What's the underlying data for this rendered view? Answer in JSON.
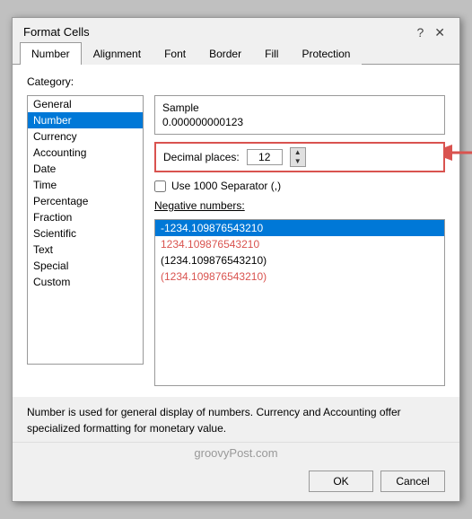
{
  "dialog": {
    "title": "Format Cells",
    "help_btn": "?",
    "close_btn": "✕"
  },
  "tabs": [
    {
      "label": "Number",
      "active": true
    },
    {
      "label": "Alignment",
      "active": false
    },
    {
      "label": "Font",
      "active": false
    },
    {
      "label": "Border",
      "active": false
    },
    {
      "label": "Fill",
      "active": false
    },
    {
      "label": "Protection",
      "active": false
    }
  ],
  "category": {
    "label": "Category:",
    "items": [
      "General",
      "Number",
      "Currency",
      "Accounting",
      "Date",
      "Time",
      "Percentage",
      "Fraction",
      "Scientific",
      "Text",
      "Special",
      "Custom"
    ],
    "selected": "Number"
  },
  "sample": {
    "label": "Sample",
    "value": "0.000000000123"
  },
  "decimal": {
    "label": "Decimal places:",
    "value": "12"
  },
  "separator": {
    "label": "Use 1000 Separator (,)"
  },
  "negative": {
    "label": "Negative numbers:",
    "items": [
      {
        "text": "-1234.109876543210",
        "color": "blue",
        "selected": true
      },
      {
        "text": "1234.109876543210",
        "color": "red",
        "selected": false
      },
      {
        "text": "(1234.109876543210)",
        "color": "black",
        "selected": false
      },
      {
        "text": "(1234.109876543210)",
        "color": "red",
        "selected": false
      }
    ]
  },
  "description": "Number is used for general display of numbers.  Currency and Accounting offer specialized formatting for monetary value.",
  "watermark": "groovyPost.com",
  "buttons": {
    "ok": "OK",
    "cancel": "Cancel"
  }
}
